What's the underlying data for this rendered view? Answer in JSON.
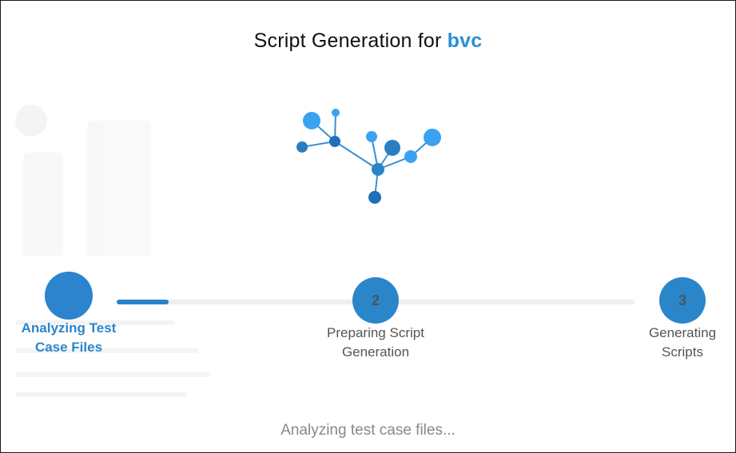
{
  "dialog": {
    "title_prefix": "Script Generation for",
    "project_name": "bvc",
    "status_text": "Analyzing test case files..."
  },
  "progress": {
    "fraction": 0.1
  },
  "steps": [
    {
      "number": "",
      "label_line1": "Analyzing Test",
      "label_line2": "Case Files",
      "state": "active"
    },
    {
      "number": "2",
      "label_line1": "Preparing Script",
      "label_line2": "Generation",
      "state": "pending"
    },
    {
      "number": "3",
      "label_line1": "Generating",
      "label_line2": "Scripts",
      "state": "pending"
    }
  ],
  "colors": {
    "accent": "#2a8fd6",
    "step_fill": "#2b86c9",
    "track": "#eeeeee"
  },
  "icons": {
    "loader": "network-graph-icon"
  }
}
